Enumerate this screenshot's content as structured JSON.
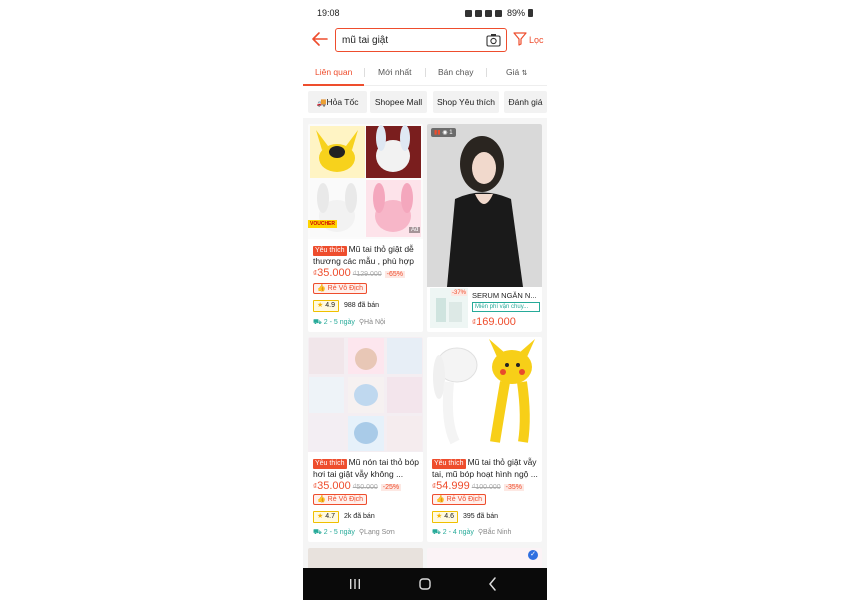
{
  "status": {
    "time": "19:08",
    "battery": "89%"
  },
  "search": {
    "value": "mũ tai giật",
    "filter_label": "Lọc"
  },
  "tabs": [
    {
      "label": "Liên quan"
    },
    {
      "label": "Mới nhất"
    },
    {
      "label": "Bán chạy"
    },
    {
      "label": "Giá"
    }
  ],
  "chips": [
    {
      "label": "Hỏa Tốc"
    },
    {
      "label": "Shopee Mall"
    },
    {
      "label": "Shop Yêu thích"
    },
    {
      "label": "Đánh giá"
    }
  ],
  "products": [
    {
      "fav": "Yêu thích",
      "title": "Mũ tai thỏ giật dễ thương các mẫu , phù hợp ...",
      "currency": "₫",
      "price": "35.000",
      "old_price": "₫129.000",
      "discount": "-65%",
      "badge": "Rẻ Vô Địch",
      "rating": "4.9",
      "sold": "988 đã bán",
      "ship_time": "2 - 5 ngày",
      "location": "Hà Nội",
      "voucher": "VOUCHER",
      "ad": "Ad"
    },
    {
      "serum_discount": "-37%",
      "serum_title": "SERUM NGĂN N...",
      "free_ship": "Miễn phí vận chuy...",
      "currency": "₫",
      "price": "169.000",
      "live": "1"
    },
    {
      "fav": "Yêu thích",
      "title": "Mũ nón tai thỏ bóp hơi tai giật vẫy không ...",
      "currency": "₫",
      "price": "35.000",
      "old_price": "₫50.000",
      "discount": "-25%",
      "badge": "Rẻ Vô Địch",
      "rating": "4.7",
      "sold": "2k đã bán",
      "ship_time": "2 - 5 ngày",
      "location": "Lạng Sơn"
    },
    {
      "fav": "Yêu thích",
      "title": "Mũ tai thỏ giật vẫy tai, mũ bóp hoạt hình ngộ ...",
      "currency": "₫",
      "price": "54.999",
      "old_price": "₫100.000",
      "discount": "-35%",
      "badge": "Rẻ Vô Địch",
      "rating": "4.6",
      "sold": "395 đã bán",
      "ship_time": "2 - 4 ngày",
      "location": "Bắc Ninh"
    }
  ],
  "colors": {
    "accent": "#ee4d2d",
    "ship": "#26aa99",
    "star": "#f5b400"
  }
}
